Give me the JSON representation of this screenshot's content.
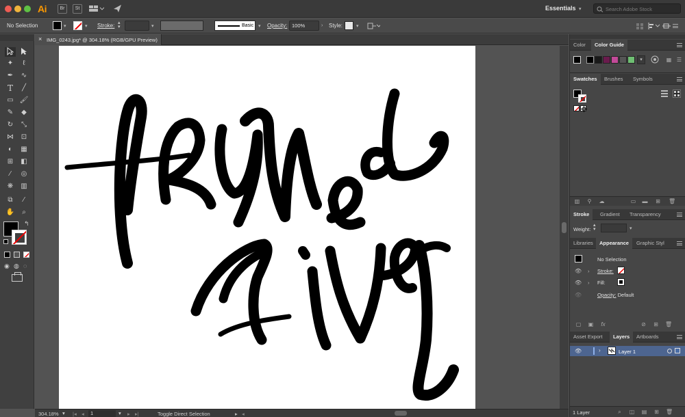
{
  "app": {
    "logo": "Ai",
    "br": "Br",
    "st": "St",
    "workspace": "Essentials",
    "stock_placeholder": "Search Adobe Stock"
  },
  "controlbar": {
    "selection": "No Selection",
    "stroke_label": "Stroke:",
    "brush_label": "Basic",
    "opacity_label": "Opacity:",
    "opacity_value": "100%",
    "style_label": "Style:"
  },
  "document": {
    "tab_close": "×",
    "tab_title": "IMG_0243.jpg* @ 304.18% (RGB/GPU Preview)"
  },
  "status": {
    "zoom": "304.18%",
    "page": "1",
    "tool_hint": "Toggle Direct Selection"
  },
  "panels": {
    "color_tabs": [
      "Color",
      "Color Guide"
    ],
    "swatch_tabs": [
      "Swatches",
      "Brushes",
      "Symbols"
    ],
    "stroke_tabs": [
      "Stroke",
      "Gradient",
      "Transparency"
    ],
    "weight_label": "Weight:",
    "appearance_tabs": [
      "Libraries",
      "Appearance",
      "Graphic Styl"
    ],
    "appearance": {
      "header": "No Selection",
      "stroke": "Stroke:",
      "fill": "Fill:",
      "opacity": "Opacity:",
      "opacity_value": "Default"
    },
    "layer_tabs": [
      "Asset Export",
      "Layers",
      "Artboards"
    ],
    "layer_name": "Layer 1",
    "layer_count": "1 Layer"
  },
  "colors": {
    "accent_layer": "#4a6ea8",
    "guide_swatches": [
      "#000000",
      "#1a1a1a",
      "#6a1b4d",
      "#c24a98",
      "#555555",
      "#6fbf73"
    ]
  }
}
